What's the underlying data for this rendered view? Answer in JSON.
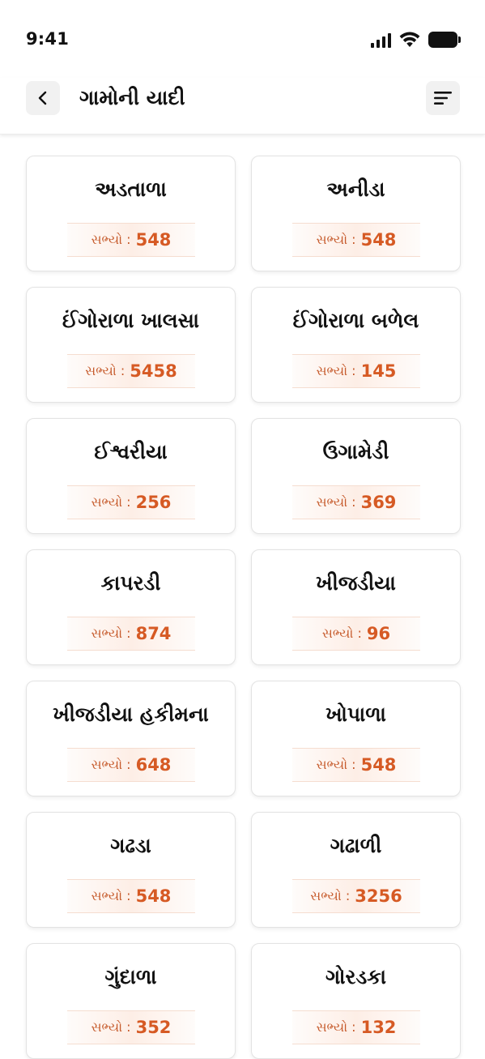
{
  "status_bar": {
    "time": "9:41"
  },
  "header": {
    "title": "ગામોની યાદી"
  },
  "member_label": "સભ્યો :",
  "colors": {
    "accent": "#d65a24",
    "pill_bg": "#fdeee6"
  },
  "villages": [
    {
      "name": "અડતાળા",
      "count": "548"
    },
    {
      "name": "અનીડા",
      "count": "548"
    },
    {
      "name": "ઈંગોરાળા ખાલસા",
      "count": "5458"
    },
    {
      "name": "ઈંગોરાળા બળેલ",
      "count": "145"
    },
    {
      "name": "ઈશ્વરીયા",
      "count": "256"
    },
    {
      "name": "ઉગામેડી",
      "count": "369"
    },
    {
      "name": "કાપરડી",
      "count": "874"
    },
    {
      "name": "ખીજડીયા",
      "count": "96"
    },
    {
      "name": "ખીજડીયા હકીમના",
      "count": "648"
    },
    {
      "name": "ખોપાળા",
      "count": "548"
    },
    {
      "name": "ગઢડા",
      "count": "548"
    },
    {
      "name": "ગઢાળી",
      "count": "3256"
    },
    {
      "name": "ગુંદાળા",
      "count": "352"
    },
    {
      "name": "ગોરડકા",
      "count": "132"
    }
  ]
}
